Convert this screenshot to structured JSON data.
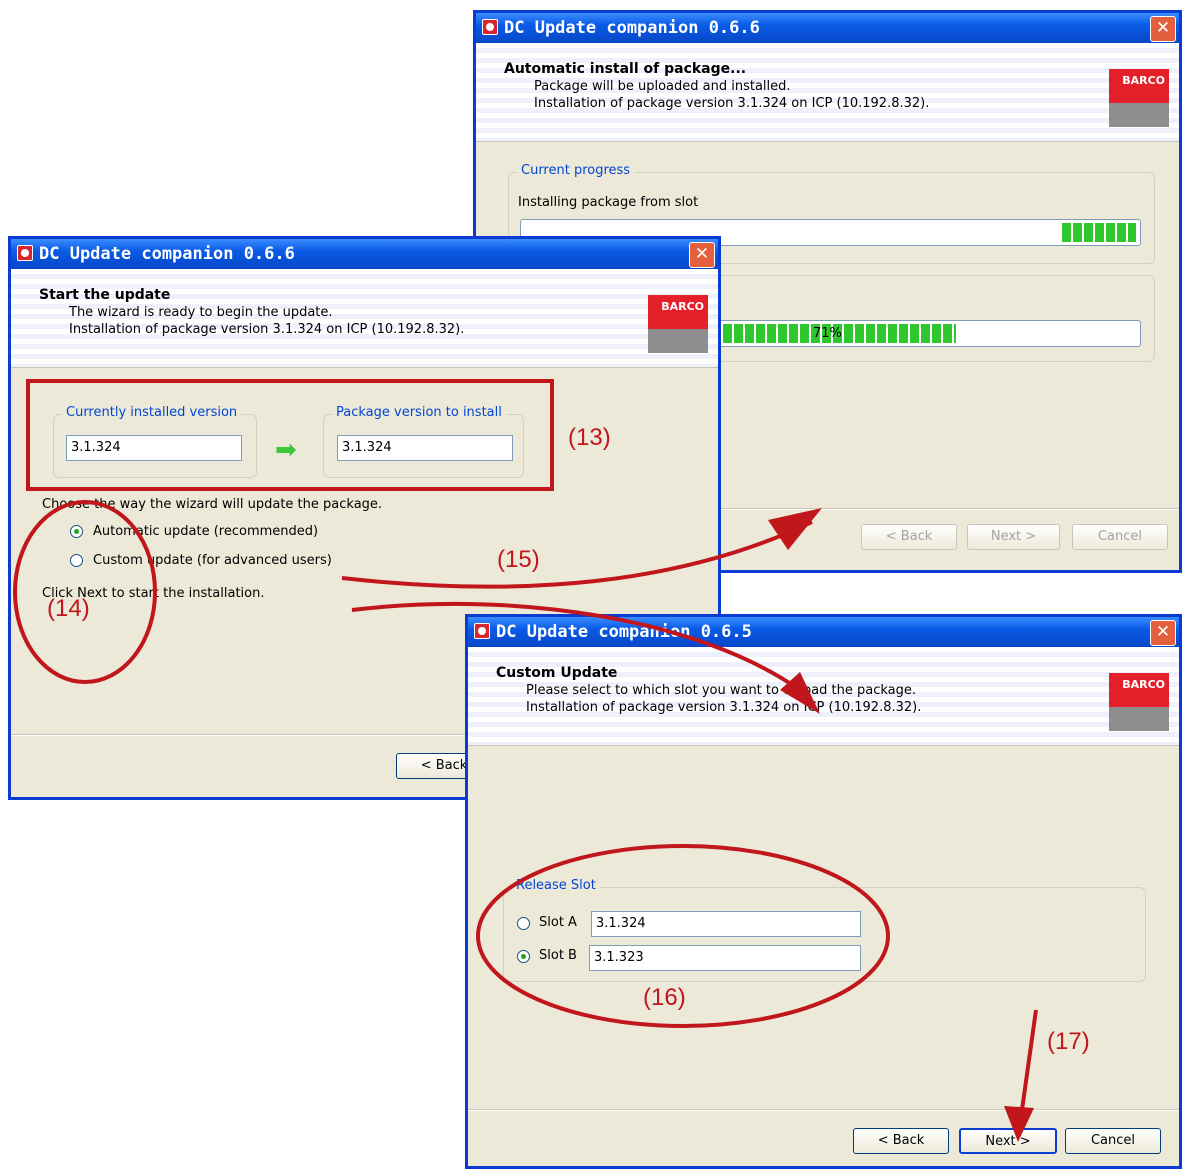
{
  "window_top": {
    "title": "DC Update companion 0.6.6",
    "header_title": "Automatic install of package...",
    "header_line1": "Package will be uploaded and installed.",
    "header_line2": "Installation of package version 3.1.324 on ICP (10.192.8.32).",
    "logo_text": "BARCO",
    "group_label": "Current progress",
    "step_label": "Installing package from slot",
    "progress_step_fraction": 0.12,
    "progress_total_fraction": 0.71,
    "progress_total_text": "71%",
    "back_label": "< Back",
    "next_label": "Next >",
    "cancel_label": "Cancel"
  },
  "window_left": {
    "title": "DC Update companion 0.6.6",
    "header_title": "Start the update",
    "header_line1": "The wizard is ready to begin the update.",
    "header_line2": "Installation of package version 3.1.324 on ICP (10.192.8.32).",
    "logo_text": "BARCO",
    "installed_label": "Currently installed version",
    "installed_value": "3.1.324",
    "package_label": "Package version to install",
    "package_value": "3.1.324",
    "choose_text": "Choose the way the wizard will update the package.",
    "auto_option": "Automatic update (recommended)",
    "custom_option": "Custom update (for advanced users)",
    "click_next_text": "Click Next to start the installation.",
    "back_label": "< Back"
  },
  "window_bottom": {
    "title": "DC Update companion 0.6.5",
    "header_title": "Custom Update",
    "header_line1": "Please select to which slot you want to upload the package.",
    "header_line2": "Installation of package version 3.1.324 on ICP (10.192.8.32).",
    "logo_text": "BARCO",
    "group_label": "Release Slot",
    "slot_a_label": "Slot A",
    "slot_a_value": "3.1.324",
    "slot_b_label": "Slot B",
    "slot_b_value": "3.1.323",
    "back_label": "< Back",
    "next_label": "Next >",
    "cancel_label": "Cancel"
  },
  "annotations": {
    "a13": "(13)",
    "a14": "(14)",
    "a15": "(15)",
    "a16": "(16)",
    "a17": "(17)"
  },
  "colors": {
    "annotation": "#c0161c",
    "titlebar": "#0a5be6",
    "progress": "#2ec72e",
    "barco_red": "#e4212b"
  }
}
